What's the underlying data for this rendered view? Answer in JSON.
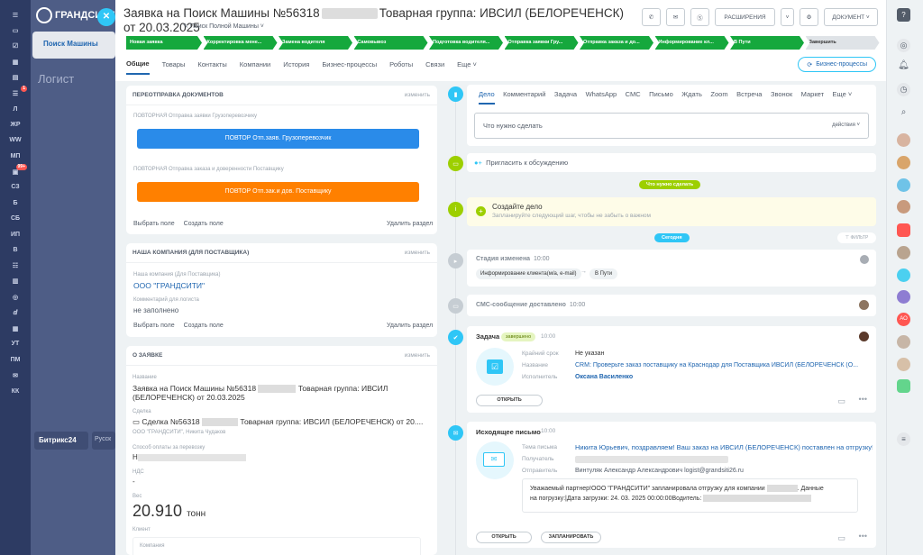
{
  "rail": {
    "items": [
      "Л",
      "ЖР",
      "WW",
      "МП",
      "Л",
      "СЗ",
      "Б",
      "СБ",
      "ИП",
      "В",
      "УТ",
      "ПМ",
      "КК"
    ],
    "badge1": "1",
    "badge2": "99+"
  },
  "background": {
    "logo": "ГРАНДСИТИ",
    "logo_sub": "ГРУППА КОМПАНИЙ",
    "button": "Поиск Машины",
    "title": "Логист",
    "b24": "Битрикс24",
    "lang": "Русск"
  },
  "header": {
    "title_part1": "Заявка на Поиск Машины №56318",
    "title_part2": "Товарная группа: ИВСИЛ (БЕЛОРЕЧЕНСК) от 20.03.2025",
    "category": "Поиск Полной Машины",
    "buttons": {
      "ext": "РАСШИРЕНИЯ",
      "doc": "ДОКУМЕНТ"
    }
  },
  "stages": [
    "Новая заявка",
    "Корректировка мене...",
    "Замена водителя",
    "Самовывоз",
    "Подготовка водителя...",
    "Отправка заявки Гру...",
    "Отправка заказа и до...",
    "Информирование кл...",
    "В Пути",
    "Завершить"
  ],
  "tabs": [
    "Общие",
    "Товары",
    "Контакты",
    "Компании",
    "История",
    "Бизнес-процессы",
    "Роботы",
    "Связи",
    "Еще"
  ],
  "bp_button": "Бизнес-процессы",
  "card1": {
    "title": "ПЕРЕОТПРАВКА ДОКУМЕНТОВ",
    "edit": "изменить",
    "label1": "ПОВТОРНАЯ Отправка заявки Грузоперевозчику",
    "btn1": "ПОВТОР Отп.заяв. Грузоперевозчик",
    "label2": "ПОВТОРНАЯ Отправка заказа и доверенности Поставщику",
    "btn2": "ПОВТОР Отп.зак.и дов. Поставщику",
    "link_select": "Выбрать поле",
    "link_create": "Создать поле",
    "link_delete": "Удалить раздел"
  },
  "card2": {
    "title": "НАША КОМПАНИЯ (ДЛЯ ПОСТАВЩИКА)",
    "edit": "изменить",
    "company_label": "Наша компания (Для Поставщика)",
    "company_value": "ООО \"ГРАНДСИТИ\"",
    "comment_label": "Комментарий для логиста",
    "comment_value": "не заполнено",
    "link_select": "Выбрать поле",
    "link_create": "Создать поле",
    "link_delete": "Удалить раздел"
  },
  "card3": {
    "title": "О ЗАЯВКЕ",
    "edit": "изменить",
    "name_label": "Название",
    "name_value1": "Заявка на Поиск Машины №56318",
    "name_value2": "Товарная группа: ИВСИЛ",
    "name_value3": "(БЕЛОРЕЧЕНСК) от 20.03.2025",
    "deal_label": "Сделка",
    "deal_value1": "Сделка №56318",
    "deal_value2": "Товарная группа: ИВСИЛ (БЕЛОРЕЧЕНСК) от 20....",
    "deal_sub": "ООО \"ГРАНДСИТИ\", Никита Чудаков",
    "pay_label": "Способ оплаты за перевозку",
    "pay_value": "Н",
    "vat_label": "НДС",
    "vat_value": "-",
    "weight_label": "Вес",
    "weight_value": "20.910",
    "weight_unit": "тонн",
    "client_label": "Клиент",
    "company_sub": "Компания"
  },
  "activity": {
    "tabs": [
      "Дело",
      "Комментарий",
      "Задача",
      "WhatsApp",
      "СМС",
      "Письмо",
      "Ждать",
      "Zoom",
      "Встреча",
      "Звонок",
      "Маркет",
      "Еще"
    ],
    "todo_placeholder": "Что нужно сделать",
    "todo_actions": "действия",
    "invite": "Пригласить к обсуждению",
    "need_pill": "Что нужно сделать",
    "create_title": "Создайте дело",
    "create_sub": "Запланируйте следующий шаг, чтобы не забыть о важном",
    "today_pill": "Сегодня",
    "filter": "ФИЛЬТР"
  },
  "timeline": {
    "stage_title": "Стадия изменена",
    "stage_time": "10:00",
    "stage_from": "Информирование клиента(м/а, e-mail)",
    "stage_to": "В Пути",
    "sms_title": "СМС-сообщение доставлено",
    "sms_time": "10:00",
    "task_title": "Задача",
    "task_badge": "завершено",
    "task_time": "10:00",
    "deadline_label": "Крайний срок",
    "deadline_value": "Не указан",
    "tname_label": "Название",
    "tname_value": "CRM: Проверьте заказ поставщику на Краснодар для Поставщика ИВСИЛ (БЕЛОРЕЧЕНСК (О...",
    "exec_label": "Исполнитель",
    "exec_value": "Оксана Василенко",
    "open_btn": "ОТКРЫТЬ",
    "mail_title": "Исходящее письмо",
    "mail_time": "10:00",
    "subject_label": "Тема письма",
    "subject_value": "Никита Юрьевич, поздравляем! Ваш заказ на ИВСИЛ (БЕЛОРЕЧЕНСК) поставлен на отгрузку!",
    "recipient_label": "Получатель",
    "sender_label": "Отправитель",
    "sender_value": "Винтуляк Александр Александрович logist@grandsiti26.ru",
    "body1": "Уважаемый партнер!ООО \"ГРАНДСИТИ\" запланировала отгрузку для компании",
    "body1b": ". Данные",
    "body2": "на погрузку:|Дата загрузки: 24. 03. 2025 00:00:00Водитель: ",
    "open_btn2": "ОТКРЫТЬ",
    "plan_btn": "ЗАПЛАНИРОВАТЬ"
  },
  "colors": {
    "green": "#15a83d",
    "blue": "#2a8be9",
    "orange": "#ff8000",
    "accent": "#2fc6f6"
  }
}
